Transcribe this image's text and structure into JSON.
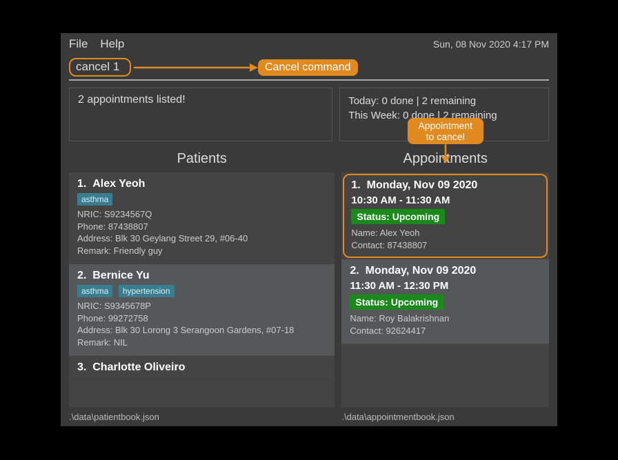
{
  "menubar": {
    "file": "File",
    "help": "Help",
    "clock": "Sun, 08 Nov 2020 4:17 PM"
  },
  "command": {
    "input_value": "cancel 1",
    "callout": "Cancel command"
  },
  "status": {
    "left": "2 appointments listed!",
    "right_line1": "Today: 0 done | 2 remaining",
    "right_line2": "This Week: 0 done | 2 remaining"
  },
  "appt_callout": "Appointment to cancel",
  "panels": {
    "patients_title": "Patients",
    "appointments_title": "Appointments"
  },
  "patients": [
    {
      "index": "1.",
      "name": "Alex Yeoh",
      "tags": [
        "asthma"
      ],
      "nric_label": "NRIC:",
      "nric": "S9234567Q",
      "phone_label": "Phone:",
      "phone": "87438807",
      "address_label": "Address:",
      "address": "Blk 30 Geylang Street 29, #06-40",
      "remark_label": "Remark:",
      "remark": "Friendly guy"
    },
    {
      "index": "2.",
      "name": "Bernice Yu",
      "tags": [
        "asthma",
        "hypertension"
      ],
      "nric_label": "NRIC:",
      "nric": "S9345678P",
      "phone_label": "Phone:",
      "phone": "99272758",
      "address_label": "Address:",
      "address": "Blk 30 Lorong 3 Serangoon Gardens, #07-18",
      "remark_label": "Remark:",
      "remark": "NIL"
    },
    {
      "index": "3.",
      "name": "Charlotte Oliveiro"
    }
  ],
  "appointments": [
    {
      "index": "1.",
      "date": "Monday, Nov 09 2020",
      "time": "10:30 AM - 11:30 AM",
      "status": "Status: Upcoming",
      "name_label": "Name:",
      "name": "Alex Yeoh",
      "contact_label": "Contact:",
      "contact": "87438807"
    },
    {
      "index": "2.",
      "date": "Monday, Nov 09 2020",
      "time": "11:30 AM - 12:30 PM",
      "status": "Status: Upcoming",
      "name_label": "Name:",
      "name": "Roy Balakrishnan",
      "contact_label": "Contact:",
      "contact": "92624417"
    }
  ],
  "footer": {
    "left": ".\\data\\patientbook.json",
    "right": ".\\data\\appointmentbook.json"
  }
}
